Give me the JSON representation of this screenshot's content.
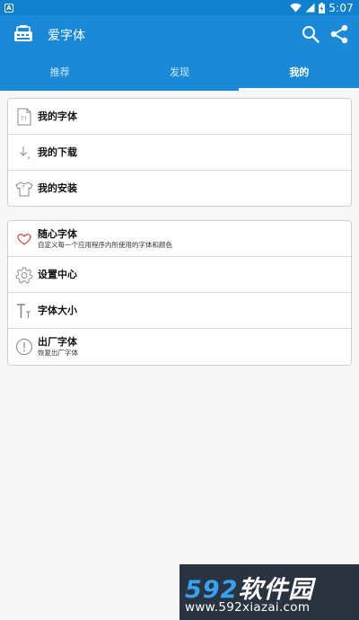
{
  "status_bar": {
    "notification_icon": "A",
    "time": "5:07",
    "battery_bolt": "⚡"
  },
  "appbar": {
    "title": "爱字体",
    "logo_icon": "font-app-logo",
    "search_icon": "search-icon",
    "share_icon": "share-icon"
  },
  "tabs": [
    {
      "label": "推荐",
      "active": false
    },
    {
      "label": "发现",
      "active": false
    },
    {
      "label": "我的",
      "active": true
    }
  ],
  "section1": {
    "items": [
      {
        "label": "我的字体",
        "icon": "font-file-icon"
      },
      {
        "label": "我的下载",
        "icon": "download-icon"
      },
      {
        "label": "我的安装",
        "icon": "shirt-icon"
      }
    ]
  },
  "section2": {
    "items": [
      {
        "label": "随心字体",
        "sub": "自定义每一个应用程序内所使用的字体和颜色",
        "icon": "heart-icon"
      },
      {
        "label": "设置中心",
        "icon": "gear-icon"
      },
      {
        "label": "字体大小",
        "icon": "text-size-icon"
      },
      {
        "label": "出厂字体",
        "sub": "恢复出厂字体",
        "icon": "exclamation-icon"
      }
    ]
  },
  "watermark": {
    "brand_num": "592",
    "brand_text": "软件园",
    "url": "www.592xiazai.com"
  },
  "colors": {
    "primary": "#1a8ad8",
    "status_bar": "#0f7fd0",
    "background": "#f7f7f7",
    "icon_gray": "#888888",
    "heart_red": "#d03030"
  }
}
